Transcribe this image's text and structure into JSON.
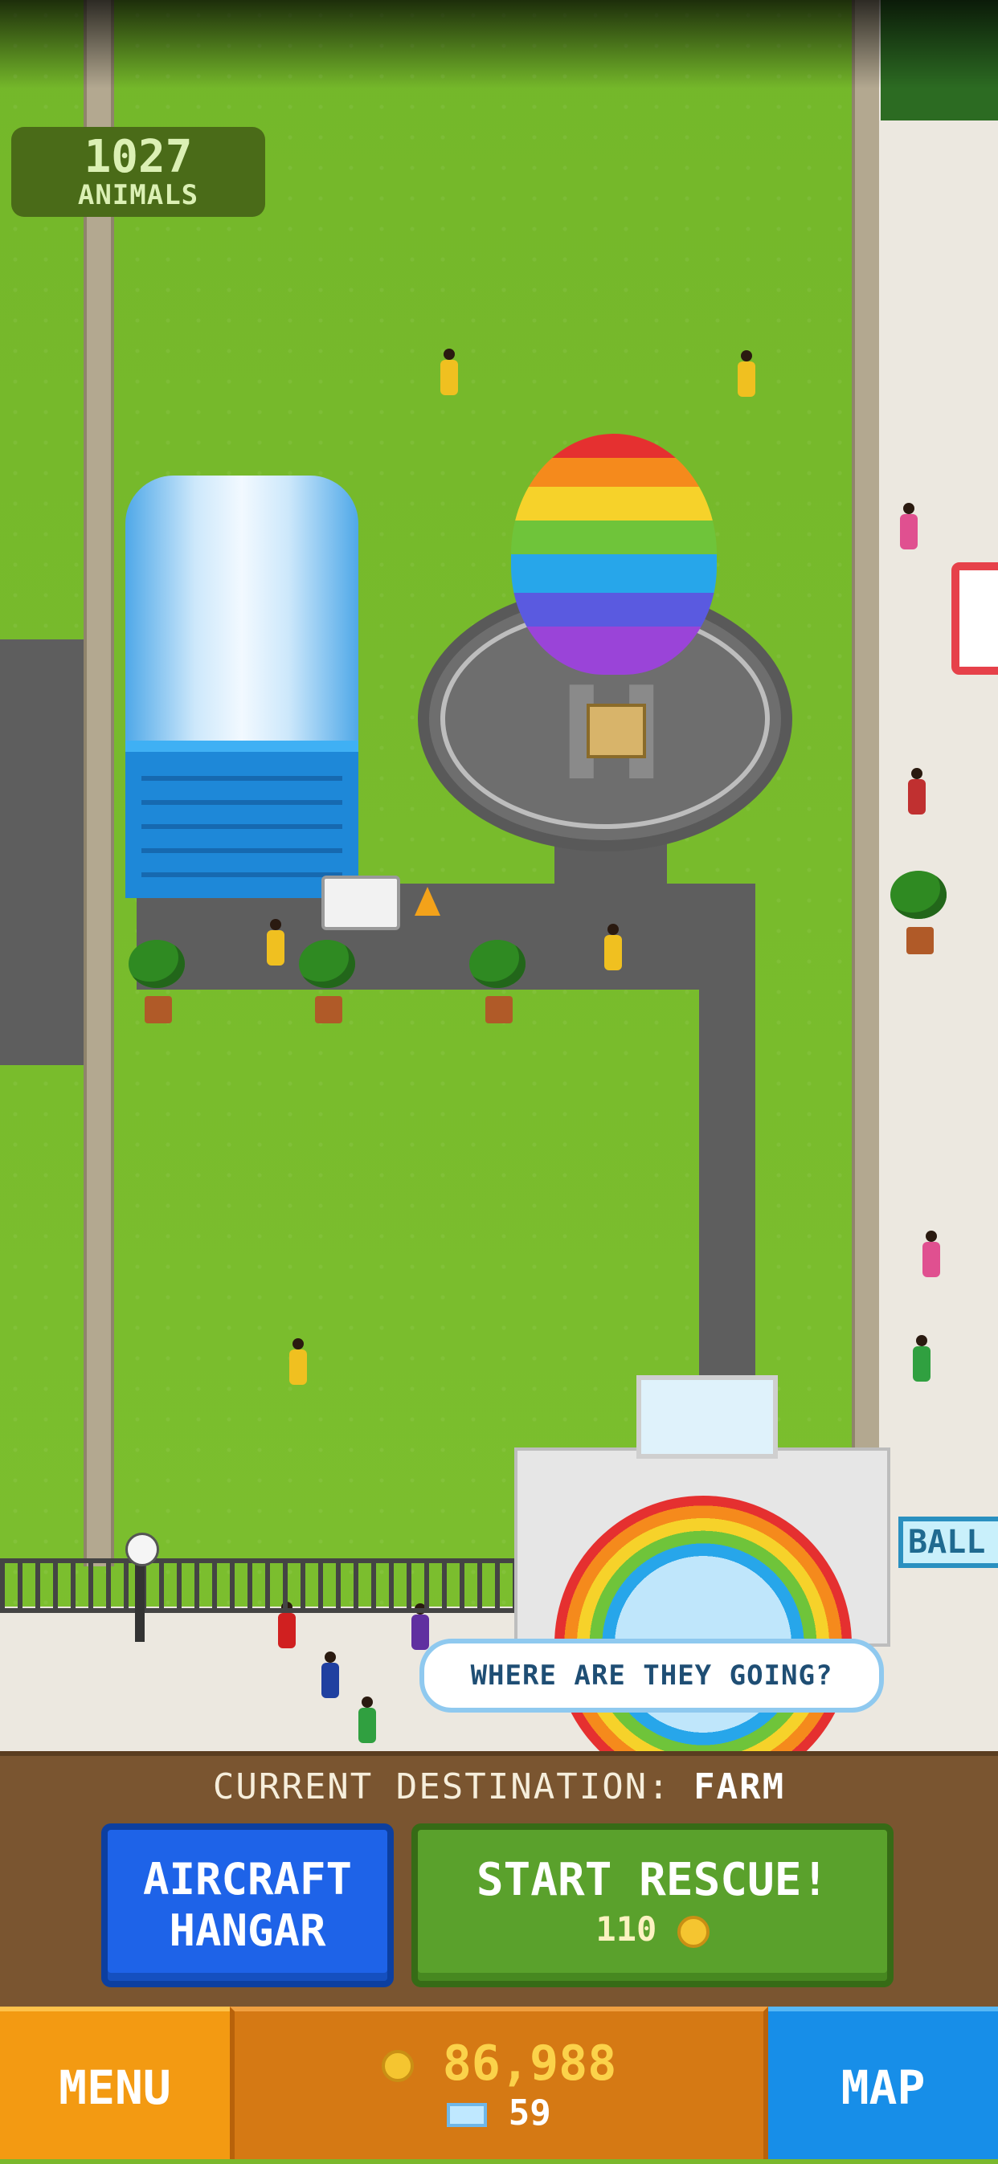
{
  "hud": {
    "animals_count": "1027",
    "animals_label": "ANIMALS"
  },
  "scene": {
    "speech_bubble": "WHERE ARE THEY GOING?",
    "shop_sign_partial": "BALL",
    "aircraft": "rainbow-hot-air-balloon"
  },
  "panel": {
    "destination_label": "CURRENT DESTINATION:",
    "destination_value": "FARM",
    "hangar_line1": "AIRCRAFT",
    "hangar_line2": "HANGAR",
    "rescue_label": "START RESCUE!",
    "rescue_cost": "110"
  },
  "bottom_bar": {
    "menu_label": "MENU",
    "coins": "86,988",
    "gems": "59",
    "map_label": "MAP"
  },
  "colors": {
    "grass": "#7ab82c",
    "hangar_button": "#1e63e8",
    "rescue_button": "#5aa12c",
    "menu_button": "#f39a12",
    "map_button": "#178ee8",
    "wallet": "#d57914"
  }
}
